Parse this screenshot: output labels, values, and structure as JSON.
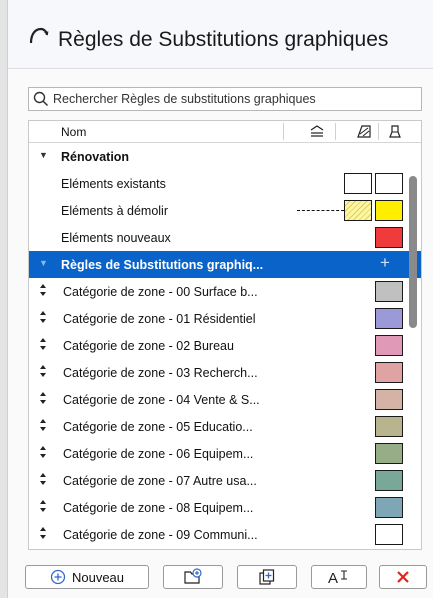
{
  "window": {
    "title": "Règles de Substitutions graphiques"
  },
  "search": {
    "placeholder": "Rechercher Règles de substitutions graphiques",
    "value": ""
  },
  "list": {
    "column_name": "Nom",
    "column_icons": [
      "fill-pattern-icon",
      "surface-icon",
      "pen-icon"
    ],
    "rows": [
      {
        "type": "group",
        "label": "Rénovation",
        "expanded": true
      },
      {
        "type": "item",
        "label": "Eléments existants",
        "swatches": [
          "#ffffff",
          "#ffffff"
        ]
      },
      {
        "type": "item",
        "label": "Eléments à démolir",
        "line": "dashed",
        "swatches": [
          "#fff7a0",
          "#ffee00"
        ]
      },
      {
        "type": "item",
        "label": "Eléments nouveaux",
        "swatches": [
          "#ef3b3b"
        ]
      },
      {
        "type": "group-selected",
        "label": "Règles de Substitutions graphiq...",
        "expanded": true
      },
      {
        "type": "sub",
        "label": "Catégorie de zone - 00 Surface b...",
        "swatch": "#c0c0c0"
      },
      {
        "type": "sub",
        "label": "Catégorie de zone - 01 Résidentiel",
        "swatch": "#9b99d8"
      },
      {
        "type": "sub",
        "label": "Catégorie de zone - 02 Bureau",
        "swatch": "#e09ab8"
      },
      {
        "type": "sub",
        "label": "Catégorie de zone - 03 Recherch...",
        "swatch": "#e0a3a3"
      },
      {
        "type": "sub",
        "label": "Catégorie de zone - 04 Vente & S...",
        "swatch": "#d4b2a6"
      },
      {
        "type": "sub",
        "label": "Catégorie de zone - 05 Educatio...",
        "swatch": "#b8b48e"
      },
      {
        "type": "sub",
        "label": "Catégorie de zone - 06 Equipem...",
        "swatch": "#97ad88"
      },
      {
        "type": "sub",
        "label": "Catégorie de zone - 07 Autre usa...",
        "swatch": "#7aa898"
      },
      {
        "type": "sub",
        "label": "Catégorie de zone - 08 Equipem...",
        "swatch": "#7ea6b4"
      },
      {
        "type": "sub",
        "label": "Catégorie de zone - 09 Communi...",
        "swatch": "#ffffff"
      }
    ]
  },
  "footer": {
    "new_label": "Nouveau",
    "buttons": [
      "new-button",
      "new-folder-button",
      "duplicate-button",
      "rename-button",
      "delete-button"
    ]
  },
  "colors": {
    "selection": "#0a63c9",
    "delete": "#e1251b",
    "accent_icon": "#3569c9"
  }
}
